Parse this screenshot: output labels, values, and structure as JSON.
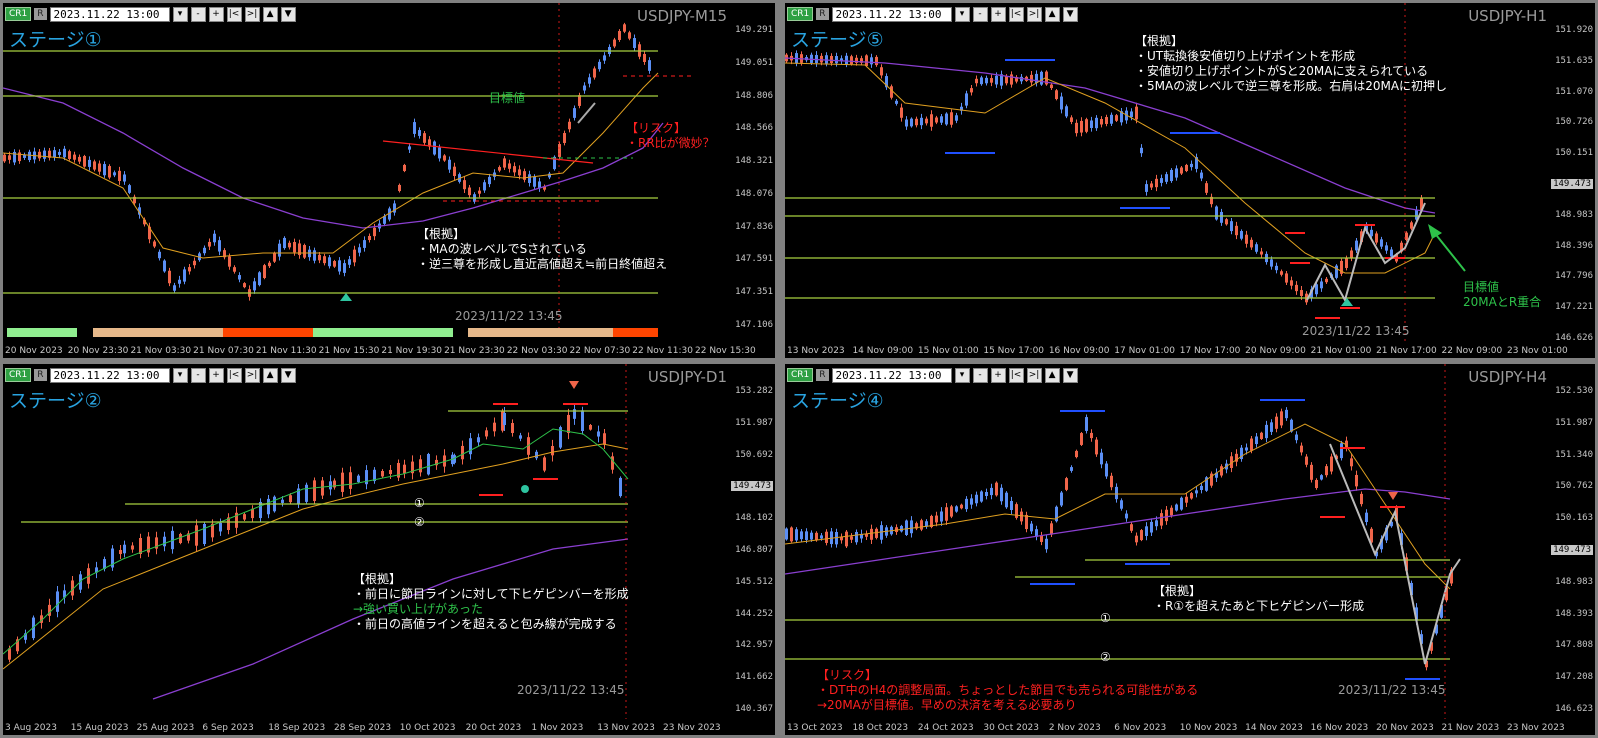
{
  "panels": {
    "m15": {
      "symbol": "CR1",
      "r": "R",
      "datetime": "2023.11.22 13:00",
      "title": "USDJPY-M15",
      "stage": "ステージ①",
      "prices": [
        "149.291",
        "149.051",
        "148.806",
        "148.566",
        "148.321",
        "148.076",
        "147.836",
        "147.591",
        "147.351",
        "147.106"
      ],
      "times": [
        "20 Nov 2023",
        "20 Nov 23:30",
        "21 Nov 03:30",
        "21 Nov 07:30",
        "21 Nov 11:30",
        "21 Nov 15:30",
        "21 Nov 19:30",
        "21 Nov 23:30",
        "22 Nov 03:30",
        "22 Nov 07:30",
        "22 Nov 11:30",
        "22 Nov 15:30"
      ],
      "target_label": "目標値",
      "risk_title": "【リスク】",
      "risk_line": "・RR比が微妙？",
      "basis_title": "【根拠】",
      "basis_lines": [
        "・MAの波レベルでSされている",
        "・逆三尊を形成し直近高値超え≒前日終値超え"
      ],
      "stamp": "2023/11/22 13:45"
    },
    "h1": {
      "symbol": "CR1",
      "r": "R",
      "datetime": "2023.11.22 13:00",
      "title": "USDJPY-H1",
      "stage": "ステージ⑤",
      "prices": [
        "151.920",
        "151.635",
        "151.070",
        "150.726",
        "150.151",
        "149.473",
        "148.983",
        "148.396",
        "147.796",
        "147.221",
        "146.626"
      ],
      "current": "149.473",
      "times": [
        "13 Nov 2023",
        "14 Nov 09:00",
        "15 Nov 01:00",
        "15 Nov 17:00",
        "16 Nov 09:00",
        "17 Nov 01:00",
        "17 Nov 17:00",
        "20 Nov 09:00",
        "21 Nov 01:00",
        "21 Nov 17:00",
        "22 Nov 09:00",
        "23 Nov 01:00"
      ],
      "basis_title": "【根拠】",
      "basis_lines": [
        "・UT転換後安値切り上げポイントを形成",
        "・安値切り上げポイントがSと20MAに支えられている",
        "・5MAの波レベルで逆三尊を形成。右肩は20MAに初押し"
      ],
      "target_lines": [
        "目標値",
        "20MAとR重合"
      ],
      "stamp": "2023/11/22 13:45"
    },
    "d1": {
      "symbol": "CR1",
      "r": "R",
      "datetime": "2023.11.22 13:00",
      "title": "USDJPY-D1",
      "stage": "ステージ②",
      "prices": [
        "153.282",
        "151.987",
        "150.692",
        "149.473",
        "148.102",
        "146.807",
        "145.512",
        "144.252",
        "142.957",
        "141.662",
        "140.367"
      ],
      "current": "149.473",
      "times": [
        "3 Aug 2023",
        "15 Aug 2023",
        "25 Aug 2023",
        "6 Sep 2023",
        "18 Sep 2023",
        "28 Sep 2023",
        "10 Oct 2023",
        "20 Oct 2023",
        "1 Nov 2023",
        "13 Nov 2023",
        "23 Nov 2023"
      ],
      "line1": "①",
      "line2": "②",
      "basis_title": "【根拠】",
      "basis_line1": "・前日に節目ラインに対して下ヒゲピンバーを形成",
      "basis_line2": "→強い買い上げがあった",
      "basis_line3": "・前日の高値ラインを超えると包み線が完成する",
      "stamp": "2023/11/22 13:45"
    },
    "h4": {
      "symbol": "CR1",
      "r": "R",
      "datetime": "2023.11.22 13:00",
      "title": "USDJPY-H4",
      "stage": "ステージ④",
      "prices": [
        "152.530",
        "151.987",
        "151.340",
        "150.762",
        "150.163",
        "149.473",
        "148.983",
        "148.393",
        "147.808",
        "147.208",
        "146.623"
      ],
      "current": "149.473",
      "times": [
        "13 Oct 2023",
        "18 Oct 2023",
        "24 Oct 2023",
        "30 Oct 2023",
        "2 Nov 2023",
        "6 Nov 2023",
        "10 Nov 2023",
        "14 Nov 2023",
        "16 Nov 2023",
        "20 Nov 2023",
        "21 Nov 2023",
        "23 Nov 2023"
      ],
      "line1": "①",
      "line2": "②",
      "basis_title": "【根拠】",
      "basis_line": "・R①を超えたあと下ヒゲピンバー形成",
      "risk_title": "【リスク】",
      "risk_line1": "・DT中のH4の調整局面。ちょっとした節目でも売られる可能性がある",
      "risk_line2": "→20MAが目標値。早めの決済を考える必要あり",
      "stamp": "2023/11/22 13:45"
    }
  },
  "colors": {
    "bull": "#5b8ff5",
    "bear": "#f0654a",
    "ma_short": "#2ec24a",
    "ma_mid": "#e0a020",
    "ma_long": "#8a3fd0",
    "level": "#a8d040",
    "stage": "#29a3e0",
    "risk": "#ff2020"
  }
}
